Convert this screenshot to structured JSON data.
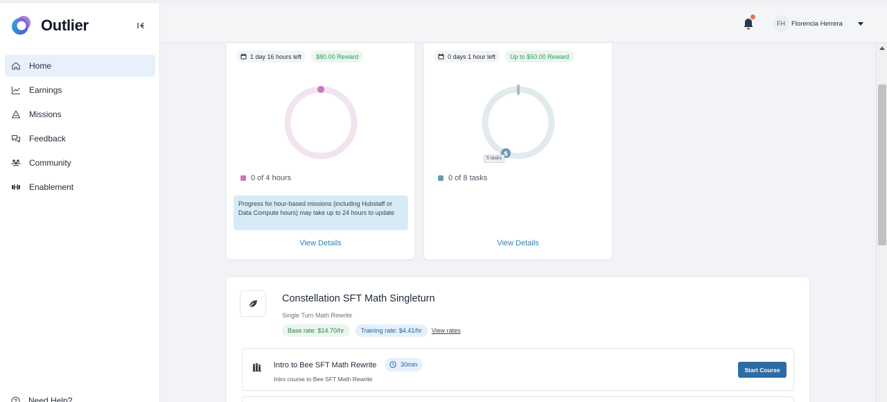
{
  "app": {
    "name": "Outlier"
  },
  "sidebar": {
    "items": [
      {
        "label": "Home",
        "icon": "home-icon",
        "active": true
      },
      {
        "label": "Earnings",
        "icon": "chart-line-icon"
      },
      {
        "label": "Missions",
        "icon": "triangle-icon"
      },
      {
        "label": "Feedback",
        "icon": "chat-bubbles-icon"
      },
      {
        "label": "Community",
        "icon": "people-icon"
      },
      {
        "label": "Enablement",
        "icon": "dumbbell-icon"
      }
    ],
    "help_label": "Need Help?"
  },
  "header": {
    "user_initials": "FH",
    "user_name": "Florencia Herrera",
    "notification_dot_color": "#ef6b5e"
  },
  "missions": [
    {
      "time_left": "1 day 16 hours left",
      "reward": "$80.00 Reward",
      "progress_label": "0 of 4 hours",
      "progress_fraction": 0,
      "ring_color": "#f1e4ef",
      "marker_color": "#c678c0",
      "note": "Progress for hour-based missions (including Hubstaff or Data Compute hours) may take up to 24 hours to update",
      "view_details": "View Details"
    },
    {
      "time_left": "0 days 1 hour left",
      "reward": "Up to $50.00 Reward",
      "progress_label": "0 of 8 tasks",
      "progress_fraction": 0,
      "ring_color": "#e3eaee",
      "marker_color": "#6a9ab0",
      "task_marker": "5 tasks",
      "view_details": "View Details"
    }
  ],
  "project": {
    "title": "Constellation SFT Math Singleturn",
    "subtitle": "Single Turn Math Rewrite",
    "base_rate": "Base rate: $14.70/hr",
    "training_rate": "Training rate: $4.41/hr",
    "view_rates": "View rates",
    "courses": [
      {
        "title": "Intro to Bee SFT Math Rewrite",
        "duration": "30min",
        "description": "Intro course to Bee SFT Math Rewrite",
        "button": "Start Course"
      }
    ]
  }
}
